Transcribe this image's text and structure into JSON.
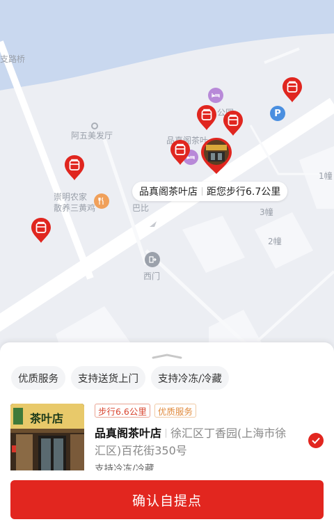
{
  "map": {
    "labels": {
      "bridge": "支路桥",
      "hair_salon": "阿五美发厅",
      "store_partial": "品真阁茶叶",
      "restaurant": "崇明农家\n散养三黄鸡",
      "babi": "巴比",
      "building_3": "3幢",
      "building_2": "2幢",
      "building_1": "1幢",
      "west_gate": "西门",
      "park": "公园"
    },
    "callout": {
      "store_name": "品真阁茶叶店",
      "distance": "距您步行6.7公里"
    },
    "parking_icon": "P",
    "colors": {
      "pin": "#e0261f",
      "water": "#c9d8ef",
      "land": "#eceef3",
      "road": "#ffffff"
    }
  },
  "panel": {
    "filters": [
      "优质服务",
      "支持送货上门",
      "支持冷冻/冷藏"
    ],
    "store": {
      "tag_walk": "步行6.6公里",
      "tag_service": "优质服务",
      "name": "品真阁茶叶店",
      "address": "徐汇区丁香园(上海市徐汇区)百花街350号",
      "sub": "支持冷冻/冷藏",
      "selected": true,
      "sign_text": "茶叶店"
    },
    "confirm_label": "确认自提点"
  },
  "icons": {
    "pin": "store-pin-icon",
    "hotel": "bed-icon",
    "restaurant": "fork-knife-icon",
    "gate": "exit-gate-icon",
    "parking": "parking-icon",
    "check": "check-icon",
    "drag": "drag-handle-icon"
  }
}
